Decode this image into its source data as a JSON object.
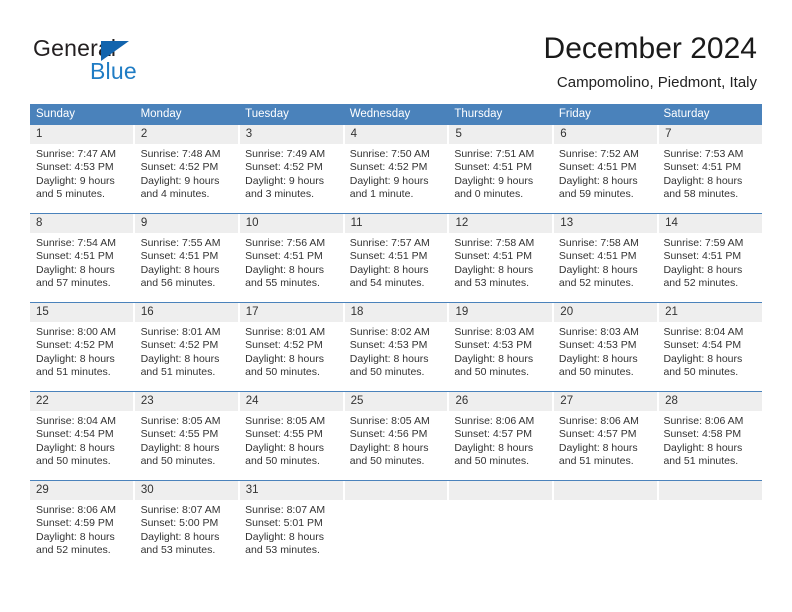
{
  "brand": {
    "name_top": "General",
    "name_bottom": "Blue",
    "accent_color": "#1f7cc4",
    "triangle_color": "#1264ad"
  },
  "header": {
    "title": "December 2024",
    "subtitle": "Campomolino, Piedmont, Italy"
  },
  "theme": {
    "header_row_bg": "#4a82bb",
    "date_band_bg": "#eeeeee",
    "cell_bg": "#ffffff",
    "text_color": "#333333"
  },
  "calendar": {
    "weekday_headers": [
      "Sunday",
      "Monday",
      "Tuesday",
      "Wednesday",
      "Thursday",
      "Friday",
      "Saturday"
    ],
    "weeks": [
      [
        {
          "date": "1",
          "sunrise": "Sunrise: 7:47 AM",
          "sunset": "Sunset: 4:53 PM",
          "daylight1": "Daylight: 9 hours",
          "daylight2": "and 5 minutes."
        },
        {
          "date": "2",
          "sunrise": "Sunrise: 7:48 AM",
          "sunset": "Sunset: 4:52 PM",
          "daylight1": "Daylight: 9 hours",
          "daylight2": "and 4 minutes."
        },
        {
          "date": "3",
          "sunrise": "Sunrise: 7:49 AM",
          "sunset": "Sunset: 4:52 PM",
          "daylight1": "Daylight: 9 hours",
          "daylight2": "and 3 minutes."
        },
        {
          "date": "4",
          "sunrise": "Sunrise: 7:50 AM",
          "sunset": "Sunset: 4:52 PM",
          "daylight1": "Daylight: 9 hours",
          "daylight2": "and 1 minute."
        },
        {
          "date": "5",
          "sunrise": "Sunrise: 7:51 AM",
          "sunset": "Sunset: 4:51 PM",
          "daylight1": "Daylight: 9 hours",
          "daylight2": "and 0 minutes."
        },
        {
          "date": "6",
          "sunrise": "Sunrise: 7:52 AM",
          "sunset": "Sunset: 4:51 PM",
          "daylight1": "Daylight: 8 hours",
          "daylight2": "and 59 minutes."
        },
        {
          "date": "7",
          "sunrise": "Sunrise: 7:53 AM",
          "sunset": "Sunset: 4:51 PM",
          "daylight1": "Daylight: 8 hours",
          "daylight2": "and 58 minutes."
        }
      ],
      [
        {
          "date": "8",
          "sunrise": "Sunrise: 7:54 AM",
          "sunset": "Sunset: 4:51 PM",
          "daylight1": "Daylight: 8 hours",
          "daylight2": "and 57 minutes."
        },
        {
          "date": "9",
          "sunrise": "Sunrise: 7:55 AM",
          "sunset": "Sunset: 4:51 PM",
          "daylight1": "Daylight: 8 hours",
          "daylight2": "and 56 minutes."
        },
        {
          "date": "10",
          "sunrise": "Sunrise: 7:56 AM",
          "sunset": "Sunset: 4:51 PM",
          "daylight1": "Daylight: 8 hours",
          "daylight2": "and 55 minutes."
        },
        {
          "date": "11",
          "sunrise": "Sunrise: 7:57 AM",
          "sunset": "Sunset: 4:51 PM",
          "daylight1": "Daylight: 8 hours",
          "daylight2": "and 54 minutes."
        },
        {
          "date": "12",
          "sunrise": "Sunrise: 7:58 AM",
          "sunset": "Sunset: 4:51 PM",
          "daylight1": "Daylight: 8 hours",
          "daylight2": "and 53 minutes."
        },
        {
          "date": "13",
          "sunrise": "Sunrise: 7:58 AM",
          "sunset": "Sunset: 4:51 PM",
          "daylight1": "Daylight: 8 hours",
          "daylight2": "and 52 minutes."
        },
        {
          "date": "14",
          "sunrise": "Sunrise: 7:59 AM",
          "sunset": "Sunset: 4:51 PM",
          "daylight1": "Daylight: 8 hours",
          "daylight2": "and 52 minutes."
        }
      ],
      [
        {
          "date": "15",
          "sunrise": "Sunrise: 8:00 AM",
          "sunset": "Sunset: 4:52 PM",
          "daylight1": "Daylight: 8 hours",
          "daylight2": "and 51 minutes."
        },
        {
          "date": "16",
          "sunrise": "Sunrise: 8:01 AM",
          "sunset": "Sunset: 4:52 PM",
          "daylight1": "Daylight: 8 hours",
          "daylight2": "and 51 minutes."
        },
        {
          "date": "17",
          "sunrise": "Sunrise: 8:01 AM",
          "sunset": "Sunset: 4:52 PM",
          "daylight1": "Daylight: 8 hours",
          "daylight2": "and 50 minutes."
        },
        {
          "date": "18",
          "sunrise": "Sunrise: 8:02 AM",
          "sunset": "Sunset: 4:53 PM",
          "daylight1": "Daylight: 8 hours",
          "daylight2": "and 50 minutes."
        },
        {
          "date": "19",
          "sunrise": "Sunrise: 8:03 AM",
          "sunset": "Sunset: 4:53 PM",
          "daylight1": "Daylight: 8 hours",
          "daylight2": "and 50 minutes."
        },
        {
          "date": "20",
          "sunrise": "Sunrise: 8:03 AM",
          "sunset": "Sunset: 4:53 PM",
          "daylight1": "Daylight: 8 hours",
          "daylight2": "and 50 minutes."
        },
        {
          "date": "21",
          "sunrise": "Sunrise: 8:04 AM",
          "sunset": "Sunset: 4:54 PM",
          "daylight1": "Daylight: 8 hours",
          "daylight2": "and 50 minutes."
        }
      ],
      [
        {
          "date": "22",
          "sunrise": "Sunrise: 8:04 AM",
          "sunset": "Sunset: 4:54 PM",
          "daylight1": "Daylight: 8 hours",
          "daylight2": "and 50 minutes."
        },
        {
          "date": "23",
          "sunrise": "Sunrise: 8:05 AM",
          "sunset": "Sunset: 4:55 PM",
          "daylight1": "Daylight: 8 hours",
          "daylight2": "and 50 minutes."
        },
        {
          "date": "24",
          "sunrise": "Sunrise: 8:05 AM",
          "sunset": "Sunset: 4:55 PM",
          "daylight1": "Daylight: 8 hours",
          "daylight2": "and 50 minutes."
        },
        {
          "date": "25",
          "sunrise": "Sunrise: 8:05 AM",
          "sunset": "Sunset: 4:56 PM",
          "daylight1": "Daylight: 8 hours",
          "daylight2": "and 50 minutes."
        },
        {
          "date": "26",
          "sunrise": "Sunrise: 8:06 AM",
          "sunset": "Sunset: 4:57 PM",
          "daylight1": "Daylight: 8 hours",
          "daylight2": "and 50 minutes."
        },
        {
          "date": "27",
          "sunrise": "Sunrise: 8:06 AM",
          "sunset": "Sunset: 4:57 PM",
          "daylight1": "Daylight: 8 hours",
          "daylight2": "and 51 minutes."
        },
        {
          "date": "28",
          "sunrise": "Sunrise: 8:06 AM",
          "sunset": "Sunset: 4:58 PM",
          "daylight1": "Daylight: 8 hours",
          "daylight2": "and 51 minutes."
        }
      ],
      [
        {
          "date": "29",
          "sunrise": "Sunrise: 8:06 AM",
          "sunset": "Sunset: 4:59 PM",
          "daylight1": "Daylight: 8 hours",
          "daylight2": "and 52 minutes."
        },
        {
          "date": "30",
          "sunrise": "Sunrise: 8:07 AM",
          "sunset": "Sunset: 5:00 PM",
          "daylight1": "Daylight: 8 hours",
          "daylight2": "and 53 minutes."
        },
        {
          "date": "31",
          "sunrise": "Sunrise: 8:07 AM",
          "sunset": "Sunset: 5:01 PM",
          "daylight1": "Daylight: 8 hours",
          "daylight2": "and 53 minutes."
        },
        {
          "date": "",
          "sunrise": "",
          "sunset": "",
          "daylight1": "",
          "daylight2": ""
        },
        {
          "date": "",
          "sunrise": "",
          "sunset": "",
          "daylight1": "",
          "daylight2": ""
        },
        {
          "date": "",
          "sunrise": "",
          "sunset": "",
          "daylight1": "",
          "daylight2": ""
        },
        {
          "date": "",
          "sunrise": "",
          "sunset": "",
          "daylight1": "",
          "daylight2": ""
        }
      ]
    ]
  }
}
